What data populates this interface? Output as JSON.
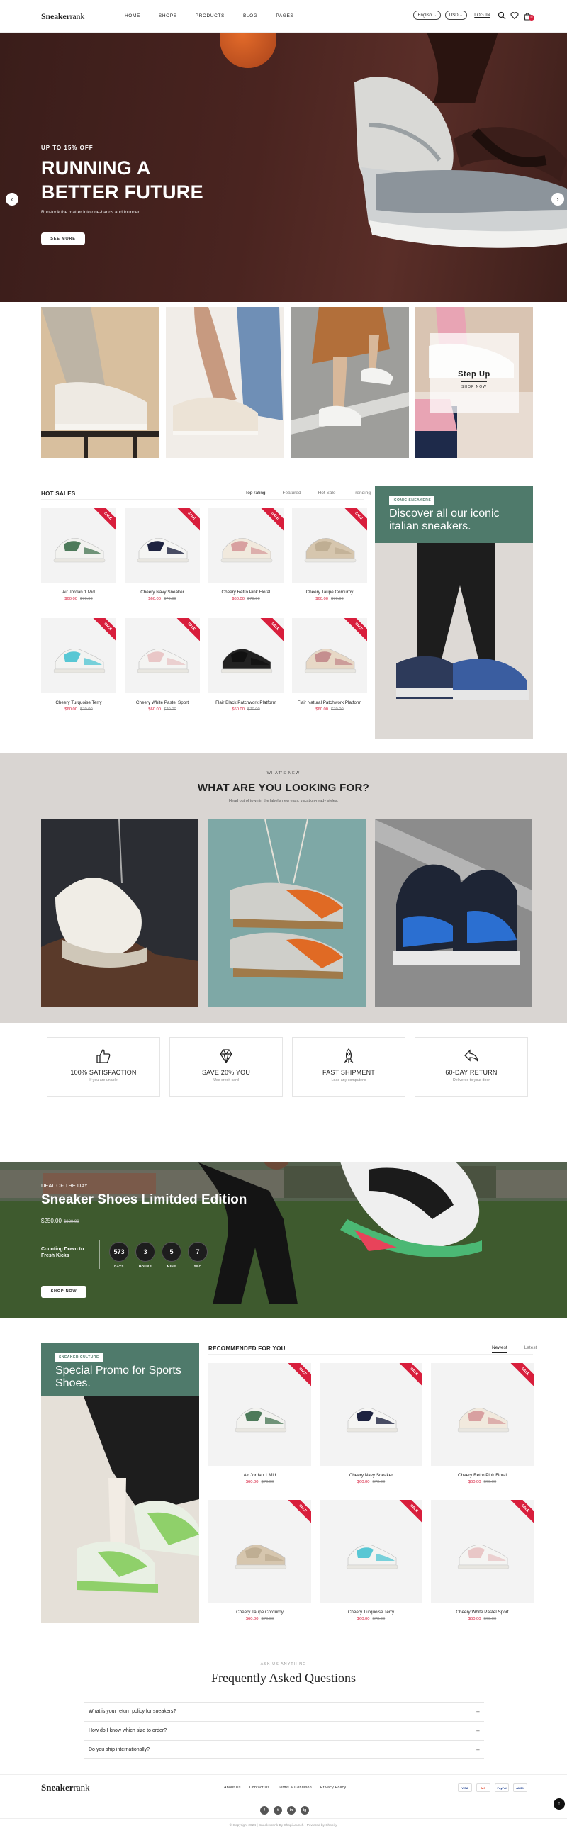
{
  "header": {
    "logo_main": "Sneaker",
    "logo_thin": "rank",
    "nav": [
      "HOME",
      "SHOPS",
      "PRODUCTS",
      "BLOG",
      "PAGES"
    ],
    "language": "English",
    "currency": "USD",
    "login": "LOG IN",
    "cart_count": "0"
  },
  "hero": {
    "eyebrow": "UP TO 15% OFF",
    "title_line1": "RUNNING A",
    "title_line2": "BETTER FUTURE",
    "subtitle": "Run-took the matter into one-hands and founded",
    "button": "SEE MORE",
    "prev": "‹",
    "next": "›"
  },
  "stepup": {
    "title": "Step Up",
    "link": "SHOP NOW"
  },
  "hot_sales": {
    "title": "HOT SALES",
    "tabs": [
      "Top rating",
      "Featured",
      "Hot Sale",
      "Trending"
    ],
    "ribbon": "SALE",
    "products": [
      {
        "name": "Air Jordan 1 Mid",
        "price": "$60.00",
        "old": "$70.00"
      },
      {
        "name": "Cheery Navy Sneaker",
        "price": "$60.00",
        "old": "$70.00"
      },
      {
        "name": "Cheery Retro Pink Floral",
        "price": "$60.00",
        "old": "$70.00"
      },
      {
        "name": "Cheery Taupe Corduroy",
        "price": "$60.00",
        "old": "$70.00"
      },
      {
        "name": "Cheery Turquoise Terry",
        "price": "$60.00",
        "old": "$70.00"
      },
      {
        "name": "Cheery White Pastel Sport",
        "price": "$60.00",
        "old": "$70.00"
      },
      {
        "name": "Flair Black Patchwork Platform",
        "price": "$60.00",
        "old": "$70.00"
      },
      {
        "name": "Flair Natural Patchwork Platform",
        "price": "$60.00",
        "old": "$70.00"
      }
    ]
  },
  "iconic": {
    "badge": "ICONIC SNEAKERS",
    "title": "Discover all our iconic italian sneakers."
  },
  "whats_new": {
    "eyebrow": "WHAT'S NEW",
    "title": "WHAT ARE YOU LOOKING FOR?",
    "subtitle": "Head out of town in the label's new easy, vacation-ready styles."
  },
  "features": [
    {
      "title": "100% SATISFACTION",
      "sub": "If you are unable",
      "icon": "thumbs-up-icon"
    },
    {
      "title": "SAVE 20% YOU",
      "sub": "Use credit card",
      "icon": "diamond-icon"
    },
    {
      "title": "FAST SHIPMENT",
      "sub": "Load any computer's",
      "icon": "rocket-icon"
    },
    {
      "title": "60-DAY RETURN",
      "sub": "Delivered to your door",
      "icon": "return-icon"
    }
  ],
  "deal": {
    "eyebrow": "DEAL OF THE DAY",
    "title": "Sneaker Shoes Limitded Edition",
    "price": "$250.00",
    "old_price": "$380.00",
    "countdown_label": "Counting Down to Fresh Kicks",
    "countdown": [
      {
        "value": "573",
        "label": "DAYS"
      },
      {
        "value": "3",
        "label": "HOURS"
      },
      {
        "value": "5",
        "label": "MINS"
      },
      {
        "value": "7",
        "label": "SEC"
      }
    ],
    "button": "SHOP NOW"
  },
  "culture": {
    "badge": "SNEAKER CULTURE",
    "title": "Special Promo for Sports Shoes."
  },
  "recommended": {
    "title": "RECOMMENDED FOR YOU",
    "tabs": [
      "Newest",
      "Latest"
    ],
    "ribbon": "SALE",
    "products": [
      {
        "name": "Air Jordan 1 Mid",
        "price": "$60.00",
        "old": "$70.00"
      },
      {
        "name": "Cheery Navy Sneaker",
        "price": "$60.00",
        "old": "$70.00"
      },
      {
        "name": "Cheery Retro Pink Floral",
        "price": "$60.00",
        "old": "$70.00"
      },
      {
        "name": "Cheery Taupe Corduroy",
        "price": "$60.00",
        "old": "$70.00"
      },
      {
        "name": "Cheery Turquoise Terry",
        "price": "$60.00",
        "old": "$70.00"
      },
      {
        "name": "Cheery White Pastel Sport",
        "price": "$60.00",
        "old": "$70.00"
      }
    ]
  },
  "faq": {
    "eyebrow": "ASK US ANYTHING",
    "title": "Frequently Asked Questions",
    "items": [
      "What is your return policy for sneakers?",
      "How do I know which size to order?",
      "Do you ship internationally?"
    ]
  },
  "footer": {
    "logo_main": "Sneaker",
    "logo_thin": "rank",
    "links": [
      "About Us",
      "Contact Us",
      "Terms & Condition",
      "Privacy Policy"
    ],
    "socials": [
      "f",
      "t",
      "in",
      "ig"
    ],
    "payments": [
      "VISA",
      "MC",
      "PayPal",
      "AMEX"
    ],
    "copyright": "© Copyright 2024 | Sneakerrank By ShopiLaunch - Powered by Shopify.",
    "to_top": "↑"
  },
  "colors": {
    "accent_red": "#d81e3c",
    "promo_green": "#4f7a6b"
  }
}
